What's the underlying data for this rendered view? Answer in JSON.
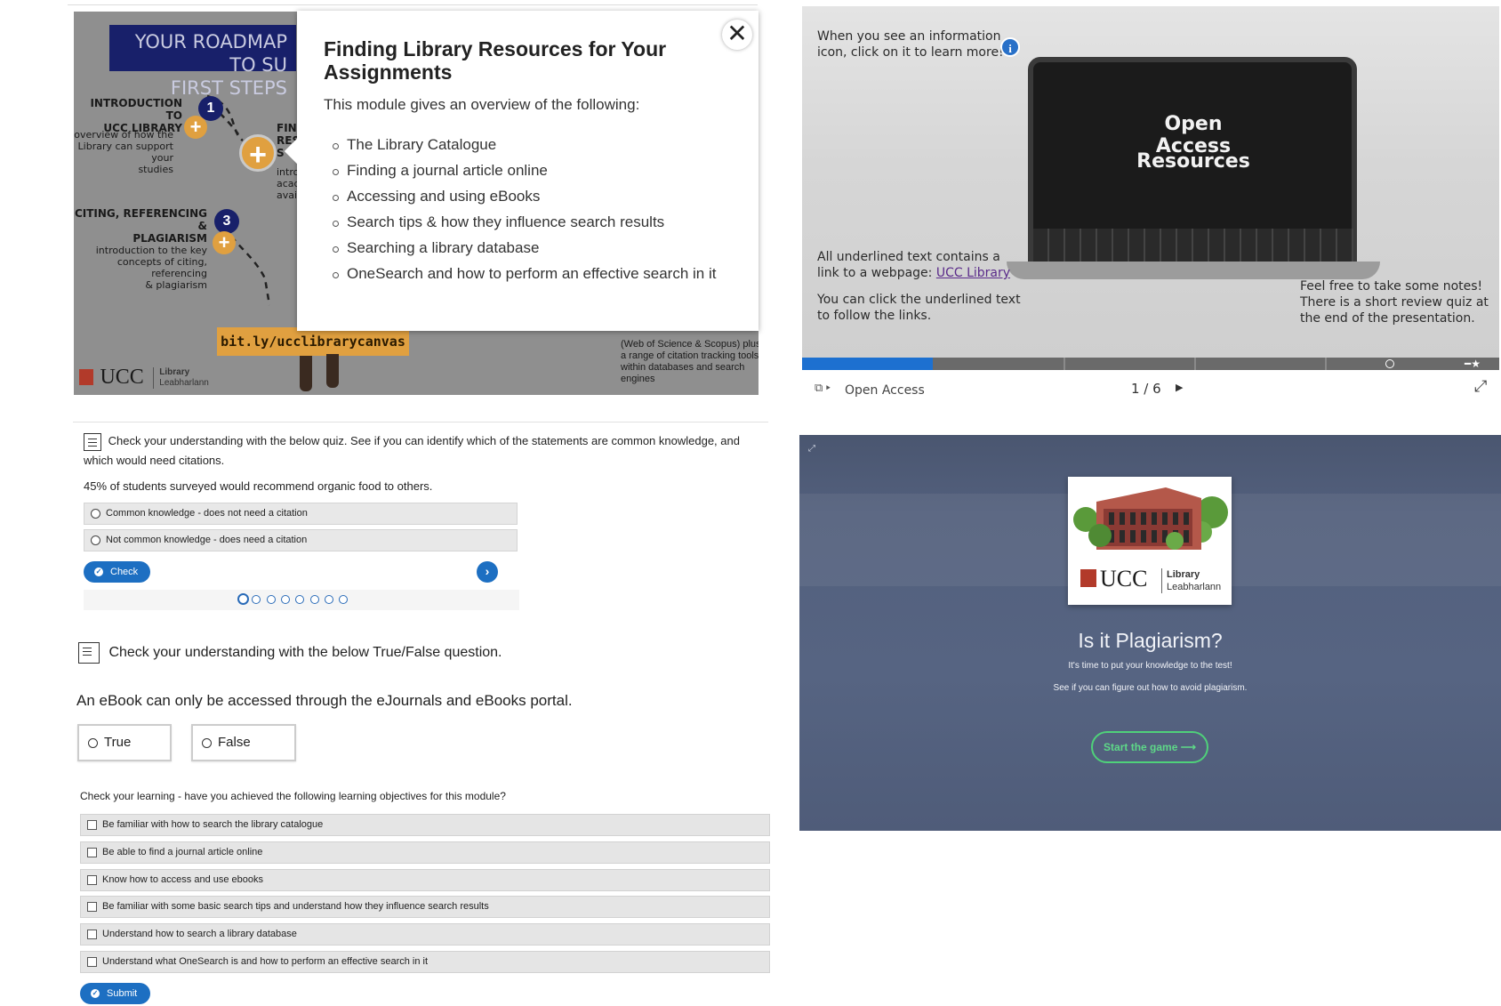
{
  "roadmap": {
    "header_line1": "YOUR ROADMAP TO SU",
    "header_line2": "FIRST STEPS",
    "step1_title_line1": "INTRODUCTION TO",
    "step1_title_line2": "UCC LIBRARY",
    "step1_desc_line1": "overview of how the",
    "step1_desc_line2": "Library can support your",
    "step1_desc_line3": "studies",
    "step1_number": "1",
    "step2_partial_line1": "FIND",
    "step2_partial_line2": "RESE",
    "step2_partial_line3": "S",
    "step2_desc_partial_line1": "introd",
    "step2_desc_partial_line2": "acade",
    "step2_desc_partial_line3": "avail",
    "step3_title_line1": "CITING, REFERENCING &",
    "step3_title_line2": "PLAGIARISM",
    "step3_number": "3",
    "step3_desc_line1": "introduction to the key",
    "step3_desc_line2": "concepts of citing, referencing",
    "step3_desc_line3": "& plagiarism",
    "url": "bit.ly/ucclibrarycanvas",
    "logo_ucc": "UCC",
    "logo_lib_line1": "Library",
    "logo_lib_line2": "Leabharlann",
    "right_text": "(Web of Science & Scopus) plus a range of citation tracking tools within databases and search engines"
  },
  "modal": {
    "close_glyph": "✕",
    "title": "Finding Library Resources for Your Assignments",
    "intro": "This module gives an overview of the following:",
    "items": [
      "The Library Catalogue",
      "Finding a journal article online",
      "Accessing and using eBooks",
      "Search tips & how they influence search results",
      "Searching a library database",
      "OneSearch and how to perform an effective search in it"
    ]
  },
  "open_access": {
    "info_text_line1": "When you see an information",
    "info_text_line2": "icon, click on it to learn more!",
    "info_icon_glyph": "i",
    "title_line1": "Open Access",
    "title_line2": "Resources",
    "underline_text_line1": "All underlined text contains a",
    "underline_text_line2": "link to a webpage: ",
    "link_text": "UCC Library",
    "click_text_line1": "You can click the underlined text",
    "click_text_line2": "to follow the links.",
    "notes_text_line1": "Feel free to take some notes!",
    "notes_text_line2": "There is a short review quiz at",
    "notes_text_line3": "the end of the presentation.",
    "toolbar_label": "Open Access",
    "page_indicator": "1 / 6",
    "progress_fraction": 0.1875,
    "accent_color": "#1d70d0"
  },
  "quiz": {
    "intro": "Check your understanding with the below quiz. See if you can identify which of the statements are common knowledge, and which would need citations.",
    "statement": "45% of students surveyed would recommend organic food to others.",
    "options": [
      "Common knowledge - does not need a citation",
      "Not common knowledge - does need a citation"
    ],
    "check_label": "Check",
    "next_glyph": "›",
    "dot_count": 8,
    "active_dot": 1
  },
  "true_false": {
    "heading": "Check your understanding with the below True/False question.",
    "question": "An eBook can only be accessed through the eJournals and eBooks portal.",
    "true_label": "True",
    "false_label": "False"
  },
  "learning_objectives": {
    "question": "Check your learning - have you achieved the following learning objectives for this module?",
    "items": [
      "Be familiar with how to search the library catalogue",
      "Be able to find a journal article online",
      "Know how to access and use ebooks",
      "Be familiar with some basic search tips and understand how they influence search results",
      "Understand how to search a library database",
      "Understand what OneSearch is and how to perform an effective search in it"
    ],
    "submit_label": "Submit"
  },
  "game": {
    "corner_glyph": "⤢",
    "logo_ucc": "UCC",
    "logo_lib_line1": "Library",
    "logo_lib_line2": "Leabharlann",
    "title": "Is it Plagiarism?",
    "subtitle1": "It's time to put your knowledge to the test!",
    "subtitle2": "See if you can figure out how to avoid plagiarism.",
    "start_label": "Start the game ⟶",
    "button_color": "#4fd17a"
  }
}
